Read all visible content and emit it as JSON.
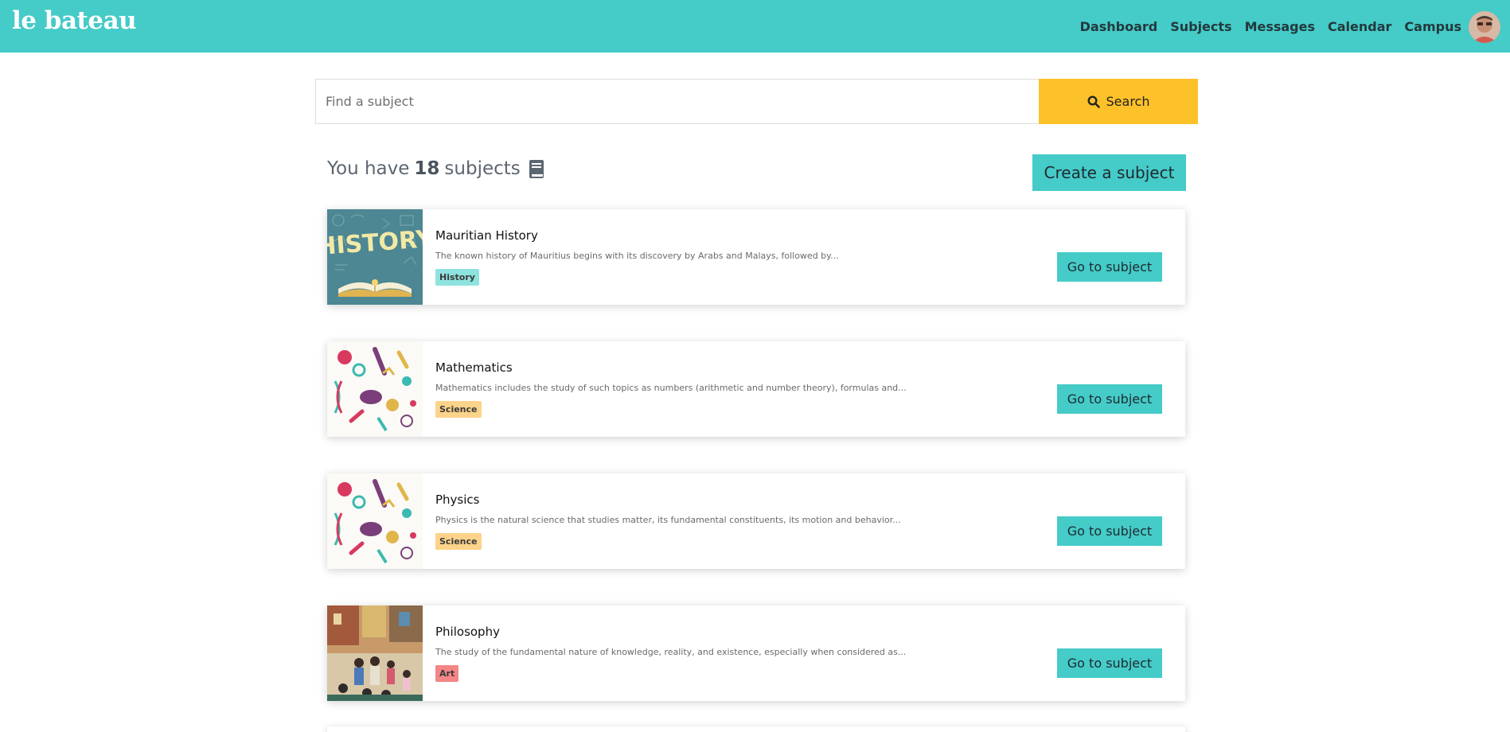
{
  "brand": "le bateau",
  "nav": {
    "items": [
      "Dashboard",
      "Subjects",
      "Messages",
      "Calendar",
      "Campus"
    ],
    "avatar": "user-avatar"
  },
  "search": {
    "placeholder": "Find a subject",
    "value": "",
    "button_label": "Search",
    "button_icon": "search-icon",
    "button_color": "#fdc12a"
  },
  "summary": {
    "prefix": "You have",
    "count": "18",
    "suffix": "subjects",
    "icon": "book-icon"
  },
  "create_button": "Create a subject",
  "accent_color": "#45cbc8",
  "subjects": [
    {
      "title": "Mauritian History",
      "description": "The known history of Mauritius begins with its discovery by Arabs and Malays, followed by...",
      "tag": "History",
      "tag_color": "#8fe3df",
      "thumbnail": "history-book-image",
      "button": "Go to subject"
    },
    {
      "title": "Mathematics",
      "description": "Mathematics includes the study of such topics as numbers (arithmetic and number theory), formulas and...",
      "tag": "Science",
      "tag_color": "#fcd38a",
      "thumbnail": "science-doodle-image",
      "button": "Go to subject"
    },
    {
      "title": "Physics",
      "description": "Physics is the natural science that studies matter, its fundamental constituents, its motion and behavior...",
      "tag": "Science",
      "tag_color": "#fcd38a",
      "thumbnail": "science-doodle-image",
      "button": "Go to subject"
    },
    {
      "title": "Philosophy",
      "description": "The study of the fundamental nature of knowledge, reality, and existence, especially when considered as...",
      "tag": "Art",
      "tag_color": "#f48686",
      "thumbnail": "painting-image",
      "button": "Go to subject"
    }
  ]
}
